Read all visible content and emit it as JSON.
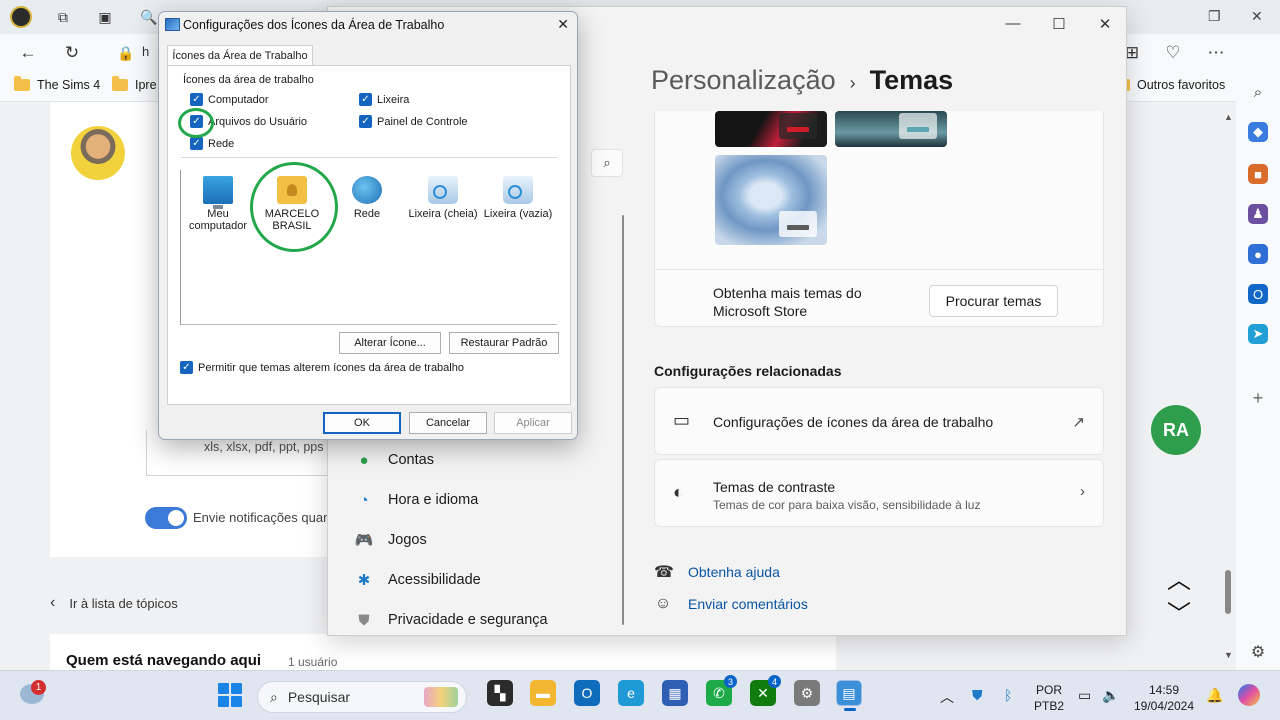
{
  "browser": {
    "favorites": [
      {
        "label": "The Sims 4"
      },
      {
        "label": "Ipre"
      }
    ],
    "other_favorites": "Outros favoritos",
    "address_prefix": "h"
  },
  "webpage": {
    "file_types": "xls, xlsx, pdf, ppt, pps",
    "notify_label": "Envie notificações quan",
    "back_link": "Ir à lista de tópicos",
    "online_title": "Quem está navegando aqui",
    "online_count": "1 usuário"
  },
  "settings": {
    "breadcrumb_parent": "Personalização",
    "breadcrumb_sep": "›",
    "breadcrumb_current": "Temas",
    "nav_items": [
      {
        "label": "Contas",
        "icon": "person-icon"
      },
      {
        "label": "Hora e idioma",
        "icon": "clock-globe-icon"
      },
      {
        "label": "Jogos",
        "icon": "gamepad-icon"
      },
      {
        "label": "Acessibilidade",
        "icon": "accessibility-icon"
      },
      {
        "label": "Privacidade e segurança",
        "icon": "shield-icon"
      }
    ],
    "more_themes_text": "Obtenha mais temas do Microsoft Store",
    "browse_button": "Procurar temas",
    "related_heading": "Configurações relacionadas",
    "desktop_icons_card": "Configurações de ícones da área de trabalho",
    "contrast_card_title": "Temas de contraste",
    "contrast_card_sub": "Temas de cor para baixa visão, sensibilidade à luz",
    "help_link": "Obtenha ajuda",
    "feedback_link": "Enviar comentários"
  },
  "dialog": {
    "title": "Configurações dos Ícones da Área de Trabalho",
    "tab": "Ícones da Área de Trabalho",
    "group_label": "Ícones da área de trabalho",
    "checkboxes": [
      {
        "label": "Computador",
        "checked": true
      },
      {
        "label": "Lixeira",
        "checked": true
      },
      {
        "label": "Arquivos do Usuário",
        "checked": true
      },
      {
        "label": "Painel de Controle",
        "checked": true
      },
      {
        "label": "Rede",
        "checked": true
      }
    ],
    "icons": [
      {
        "label": "Meu computador",
        "icon": "computer-icon"
      },
      {
        "label": "MARCELO BRASIL",
        "icon": "user-folder-icon"
      },
      {
        "label": "Rede",
        "icon": "network-icon"
      },
      {
        "label": "Lixeira (cheia)",
        "icon": "recycle-bin-full-icon"
      },
      {
        "label": "Lixeira (vazia)",
        "icon": "recycle-bin-empty-icon"
      }
    ],
    "change_icon_button": "Alterar Ícone...",
    "restore_default_button": "Restaurar Padrão",
    "allow_themes_checkbox": "Permitir que temas alterem ícones da área de trabalho",
    "ok_button": "OK",
    "cancel_button": "Cancelar",
    "apply_button": "Aplicar"
  },
  "sidebar_badge": "RA",
  "taskbar": {
    "weather_badge": "1",
    "search_placeholder": "Pesquisar",
    "whatsapp_badge": "3",
    "xbox_badge": "4",
    "language": "POR",
    "layout": "PTB2",
    "time": "14:59",
    "date": "19/04/2024"
  },
  "colors": {
    "accent": "#1565c0",
    "highlight_ring": "#22a84a",
    "link": "#0a54a6"
  }
}
